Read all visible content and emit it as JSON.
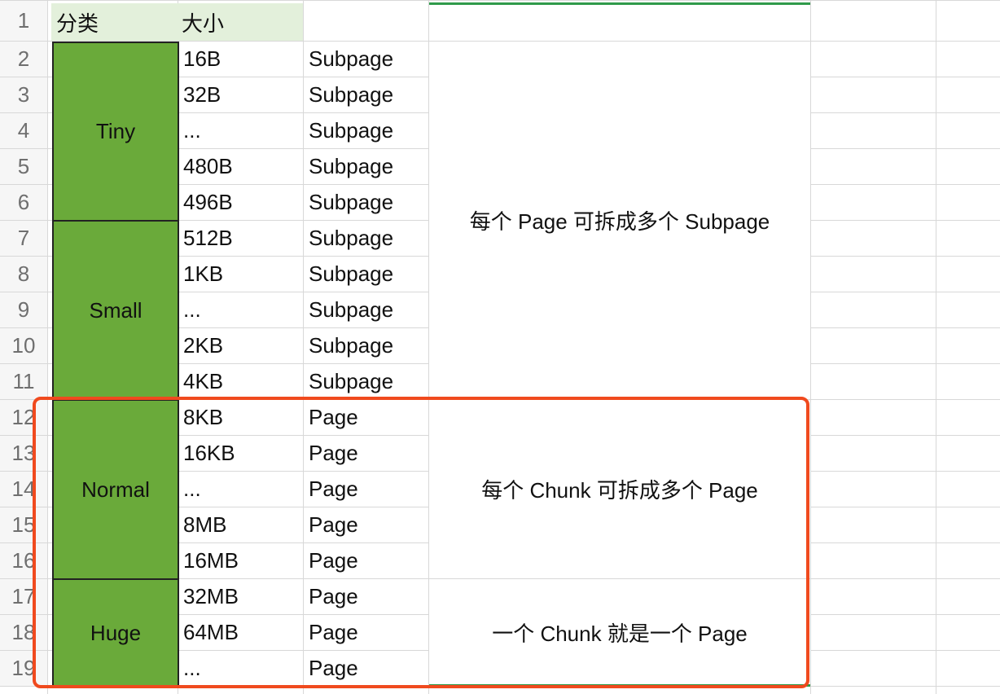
{
  "headers": {
    "category": "分类",
    "size": "大小"
  },
  "row_numbers": [
    "1",
    "2",
    "3",
    "4",
    "5",
    "6",
    "7",
    "8",
    "9",
    "10",
    "11",
    "12",
    "13",
    "14",
    "15",
    "16",
    "17",
    "18",
    "19"
  ],
  "categories": [
    {
      "label": "Tiny"
    },
    {
      "label": "Small"
    },
    {
      "label": "Normal"
    },
    {
      "label": "Huge"
    }
  ],
  "sizes": [
    "16B",
    "32B",
    "...",
    "480B",
    "496B",
    "512B",
    "1KB",
    "...",
    "2KB",
    "4KB",
    "8KB",
    "16KB",
    "...",
    "8MB",
    "16MB",
    "32MB",
    "64MB",
    "..."
  ],
  "types": [
    "Subpage",
    "Subpage",
    "Subpage",
    "Subpage",
    "Subpage",
    "Subpage",
    "Subpage",
    "Subpage",
    "Subpage",
    "Subpage",
    "Page",
    "Page",
    "Page",
    "Page",
    "Page",
    "Page",
    "Page",
    "Page"
  ],
  "notes": [
    {
      "text": "每个 Page 可拆成多个 Subpage"
    },
    {
      "text": "每个 Chunk 可拆成多个 Page"
    },
    {
      "text": "一个 Chunk 就是一个 Page"
    }
  ],
  "colors": {
    "category_fill": "#6aaa3a",
    "header_fill": "#e3f0db",
    "highlight_border": "#f04a1e",
    "selection_green": "#2f9a4a",
    "gridline": "#d8d8d8"
  }
}
